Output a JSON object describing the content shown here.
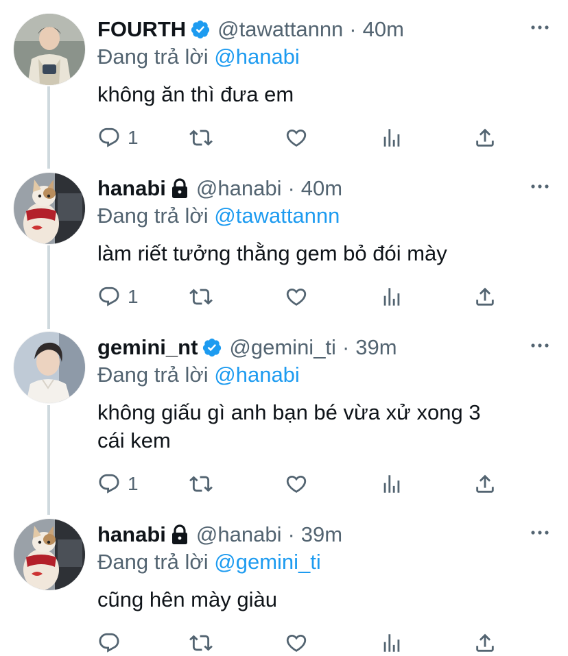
{
  "reply_prefix": "Đang trả lời",
  "colors": {
    "accent": "#1d9bf0",
    "secondary": "#536471",
    "thread_line": "#cfd9de"
  },
  "icons": [
    "verified-badge-icon",
    "lock-icon",
    "more-icon",
    "reply-icon",
    "retweet-icon",
    "like-icon",
    "analytics-icon",
    "share-icon"
  ],
  "tweets": [
    {
      "name": "FOURTH",
      "badge": "verified-badge-icon",
      "handle": "@tawattannn",
      "dot": "·",
      "time": "40m",
      "reply_to": "@hanabi",
      "text": "không ăn thì đưa em",
      "reply_count": "1"
    },
    {
      "name": "hanabi",
      "badge": "lock-icon",
      "handle": "@hanabi",
      "dot": "·",
      "time": "40m",
      "reply_to": "@tawattannn",
      "text": "làm riết tưởng thằng gem bỏ đói mày",
      "reply_count": "1"
    },
    {
      "name": "gemini_nt",
      "badge": "verified-badge-icon",
      "handle": "@gemini_ti",
      "dot": "·",
      "time": "39m",
      "reply_to": "@hanabi",
      "text_lines": [
        "không giấu gì anh bạn bé vừa xử xong 3",
        "cái kem"
      ],
      "reply_count": "1"
    },
    {
      "name": "hanabi",
      "badge": "lock-icon",
      "handle": "@hanabi",
      "dot": "·",
      "time": "39m",
      "reply_to": "@gemini_ti",
      "text": "cũng hên mày giàu",
      "reply_count": ""
    }
  ]
}
